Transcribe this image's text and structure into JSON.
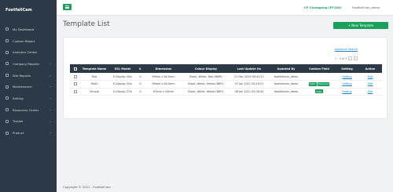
{
  "app": {
    "brand": "FootfallCam"
  },
  "sidebar": {
    "items": [
      {
        "label": "My Dashboard",
        "icon": "dashboard-icon",
        "has_children": false
      },
      {
        "label": "Custom Report",
        "icon": "report-icon",
        "has_children": false
      },
      {
        "label": "Analytics Center",
        "icon": "analytics-icon",
        "has_children": false
      },
      {
        "label": "Company Reports",
        "icon": "building-icon",
        "has_children": true
      },
      {
        "label": "Site Reports",
        "icon": "store-icon",
        "has_children": true
      },
      {
        "label": "Maintenance",
        "icon": "wrench-icon",
        "has_children": true
      },
      {
        "label": "Setting",
        "icon": "gear-icon",
        "has_children": true
      },
      {
        "label": "Resources Center",
        "icon": "book-icon",
        "has_children": true
      },
      {
        "label": "Tracker",
        "icon": "tracker-icon",
        "has_children": true
      },
      {
        "label": "Product",
        "icon": "cart-icon",
        "has_children": true
      }
    ]
  },
  "topbar": {
    "site": "CF Changping (FF109)",
    "user": "FootfallCam_demo"
  },
  "page": {
    "title": "Template List",
    "new_button": "+ New Template"
  },
  "toolbar": {
    "advance_search": "Advance Search",
    "pager": "1 - 3 of 3"
  },
  "table": {
    "headers": [
      "Template Name",
      "ESL Model",
      "Dimension",
      "Colour Display",
      "Last Update On",
      "Updated By",
      "Custom Field",
      "Setting",
      "Action"
    ],
    "rows": [
      {
        "name": "Test",
        "model": "E-Display 42in",
        "dimension": "99mm x 84.0mm",
        "colour": "Black, White, Red (BWR)",
        "updated_on": "21 Dec 2020 09:43:11",
        "updated_by": "footfallcam_demo",
        "custom_fields": [],
        "setting": "Setting",
        "action": "Edit"
      },
      {
        "name": "Test2",
        "model": "E-Display 42in",
        "dimension": "99mm x 84.0mm",
        "colour": "Black, White, Yellow (BWY)",
        "updated_on": "07 Jan 2021 05:49:21",
        "updated_by": "footfallcam_demo",
        "custom_fields": [
          "Date",
          "Discount"
        ],
        "setting": "Setting",
        "action": "Edit"
      },
      {
        "name": "Simple",
        "model": "E-Display 27in",
        "dimension": "67mm x 34mm",
        "colour": "Black, White, Yellow (BWY)",
        "updated_on": "08 Jan 2021 02:06:43",
        "updated_by": "footfallcam_demo",
        "custom_fields": [
          "Date"
        ],
        "setting": "Setting",
        "action": "Edit"
      }
    ]
  },
  "footer": {
    "copyright": "Copyright © 2021 - FootfallCam"
  },
  "colors": {
    "sidebar": "#2c3a47",
    "accent": "#1aa05b",
    "link": "#1a7fd0"
  }
}
